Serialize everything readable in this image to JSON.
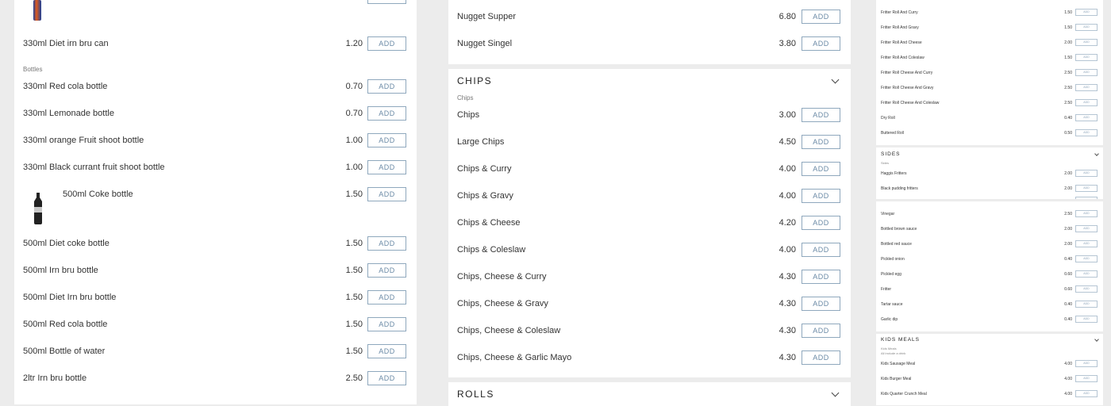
{
  "add_label": "ADD",
  "col1": {
    "items_top": [
      {
        "name": "330ml Diet irn bru can",
        "price": "1.20"
      }
    ],
    "bottles_sub": "Bottles",
    "bottles": [
      {
        "name": "330ml Red cola bottle",
        "price": "0.70"
      },
      {
        "name": "330ml Lemonade bottle",
        "price": "0.70"
      },
      {
        "name": "330ml orange Fruit shoot bottle",
        "price": "1.00"
      },
      {
        "name": "330ml Black currant fruit shoot bottle",
        "price": "1.00"
      },
      {
        "name": "500ml Coke bottle",
        "price": "1.50"
      },
      {
        "name": "500ml Diet coke bottle",
        "price": "1.50"
      },
      {
        "name": "500ml Irn bru bottle",
        "price": "1.50"
      },
      {
        "name": "500ml Diet Irn bru bottle",
        "price": "1.50"
      },
      {
        "name": "500ml Red cola bottle",
        "price": "1.50"
      },
      {
        "name": "500ml Bottle of water",
        "price": "1.50"
      },
      {
        "name": "2ltr Irn bru bottle",
        "price": "2.50"
      }
    ]
  },
  "col2": {
    "items_top": [
      {
        "name": "Nugget Supper",
        "price": "6.80"
      },
      {
        "name": "Nugget Singel",
        "price": "3.80"
      }
    ],
    "chips_title": "CHIPS",
    "chips_sub": "Chips",
    "chips": [
      {
        "name": "Chips",
        "price": "3.00"
      },
      {
        "name": "Large Chips",
        "price": "4.50"
      },
      {
        "name": "Chips & Curry",
        "price": "4.00"
      },
      {
        "name": "Chips & Gravy",
        "price": "4.00"
      },
      {
        "name": "Chips & Cheese",
        "price": "4.20"
      },
      {
        "name": "Chips & Coleslaw",
        "price": "4.00"
      },
      {
        "name": "Chips, Cheese & Curry",
        "price": "4.30"
      },
      {
        "name": "Chips, Cheese & Gravy",
        "price": "4.30"
      },
      {
        "name": "Chips, Cheese & Coleslaw",
        "price": "4.30"
      },
      {
        "name": "Chips, Cheese & Garlic Mayo",
        "price": "4.30"
      }
    ],
    "rolls_title": "ROLLS"
  },
  "col3": {
    "rolls": [
      {
        "name": "Fritter Roll And Curry",
        "price": "1.50"
      },
      {
        "name": "Fritter Roll And Gravy",
        "price": "1.50"
      },
      {
        "name": "Fritter Roll And Cheese",
        "price": "2.00"
      },
      {
        "name": "Fritter Roll And Coleslaw",
        "price": "1.50"
      },
      {
        "name": "Fritter Roll Cheese And Curry",
        "price": "2.50"
      },
      {
        "name": "Fritter Roll Cheese And Gravy",
        "price": "2.50"
      },
      {
        "name": "Fritter Roll Cheese And Coleslaw",
        "price": "2.50"
      },
      {
        "name": "Dry Roll",
        "price": "0.40"
      },
      {
        "name": "Buttered Roll",
        "price": "0.50"
      }
    ],
    "sides_title": "SIDES",
    "sides_sub": "Sides",
    "sides": [
      {
        "name": "Haggis Fritters",
        "price": "2.00"
      },
      {
        "name": "Black pudding fritters",
        "price": "2.00"
      }
    ],
    "extras": [
      {
        "name": "Vinegar",
        "price": "2.50"
      },
      {
        "name": "Bottled brown sauce",
        "price": "2.00"
      },
      {
        "name": "Bottled red sauce",
        "price": "2.00"
      },
      {
        "name": "Pickled onion",
        "price": "0.40"
      },
      {
        "name": "Pickled egg",
        "price": "0.60"
      },
      {
        "name": "Fritter",
        "price": "0.60"
      },
      {
        "name": "Tartar sauce",
        "price": "0.40"
      },
      {
        "name": "Garlic dip",
        "price": "0.40"
      }
    ],
    "kids_title": "KIDS MEALS",
    "kids_sub": "Kids Meals",
    "kids_sub2": "All include a drink",
    "kids": [
      {
        "name": "Kids Sausage Meal",
        "price": "4.00"
      },
      {
        "name": "Kids Burger Meal",
        "price": "4.00"
      },
      {
        "name": "Kids Quarter Crunch Meal",
        "price": "4.00"
      }
    ]
  }
}
